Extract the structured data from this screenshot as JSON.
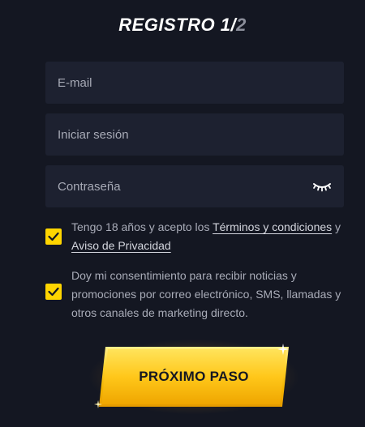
{
  "header": {
    "title_main": "REGISTRO 1",
    "title_slash": "/",
    "title_total": "2"
  },
  "form": {
    "email_placeholder": "E-mail",
    "login_placeholder": "Iniciar sesión",
    "password_placeholder": "Contraseña"
  },
  "consents": {
    "terms": {
      "checked": true,
      "text_before": "Tengo 18 años y acepto los ",
      "terms_link": "Términos y condiciones",
      "text_and": " y ",
      "privacy_link": "Aviso de Privacidad"
    },
    "marketing": {
      "checked": true,
      "text": "Doy mi consentimiento para recibir noticias y promociones por correo electrónico, SMS, llamadas y otros canales de marketing directo."
    }
  },
  "cta": {
    "label": "PRÓXIMO PASO"
  },
  "colors": {
    "background": "#141722",
    "field": "#1d2130",
    "accent": "#ffd500"
  },
  "icons": {
    "password_toggle": "eye-closed-icon",
    "checkbox": "checkmark-icon"
  }
}
